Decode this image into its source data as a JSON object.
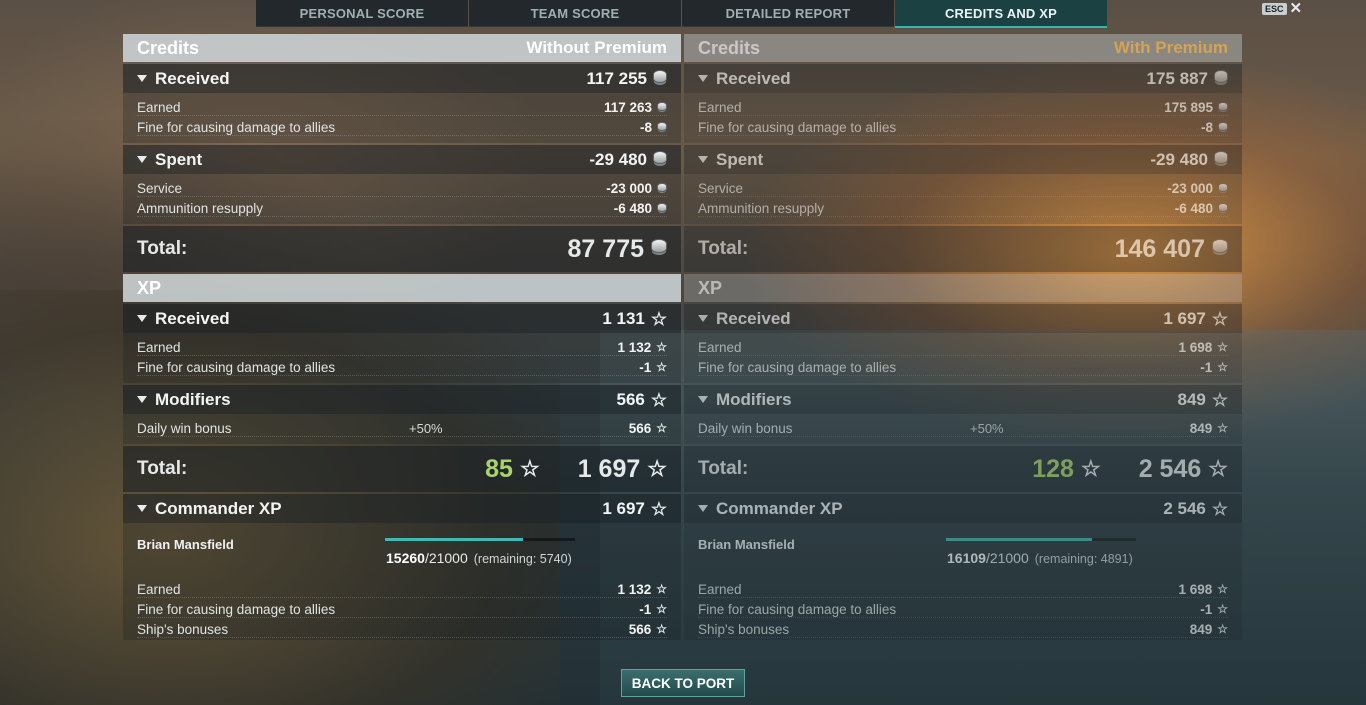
{
  "tabs": [
    {
      "label": "PERSONAL SCORE",
      "active": false
    },
    {
      "label": "TEAM SCORE",
      "active": false
    },
    {
      "label": "DETAILED REPORT",
      "active": false
    },
    {
      "label": "CREDITS AND XP",
      "active": true
    }
  ],
  "esc_label": "ESC",
  "left": {
    "credits_title": "Credits",
    "credits_mode": "Without Premium",
    "received": {
      "label": "Received",
      "value": "117 255",
      "rows": [
        {
          "label": "Earned",
          "value": "117 263"
        },
        {
          "label": "Fine for causing damage to allies",
          "value": "-8"
        }
      ]
    },
    "spent": {
      "label": "Spent",
      "value": "-29 480",
      "rows": [
        {
          "label": "Service",
          "value": "-23 000"
        },
        {
          "label": "Ammunition resupply",
          "value": "-6 480"
        }
      ]
    },
    "credits_total": {
      "label": "Total:",
      "value": "87 775"
    },
    "xp_title": "XP",
    "xp_received": {
      "label": "Received",
      "value": "1 131",
      "rows": [
        {
          "label": "Earned",
          "value": "1 132"
        },
        {
          "label": "Fine for causing damage to allies",
          "value": "-1"
        }
      ]
    },
    "modifiers": {
      "label": "Modifiers",
      "value": "566",
      "rows": [
        {
          "label": "Daily win bonus",
          "mid": "+50%",
          "value": "566"
        }
      ]
    },
    "xp_total": {
      "label": "Total:",
      "free": "85",
      "value": "1 697"
    },
    "commander": {
      "label": "Commander XP",
      "value": "1 697",
      "name": "Brian Mansfield",
      "current": "15260",
      "max": "/21000",
      "remaining": "(remaining: 5740)",
      "progress": 0.727,
      "rows": [
        {
          "label": "Earned",
          "value": "1 132"
        },
        {
          "label": "Fine for causing damage to allies",
          "value": "-1"
        },
        {
          "label": "Ship's bonuses",
          "value": "566"
        }
      ]
    }
  },
  "right": {
    "credits_title": "Credits",
    "credits_mode": "With Premium",
    "received": {
      "label": "Received",
      "value": "175 887",
      "rows": [
        {
          "label": "Earned",
          "value": "175 895"
        },
        {
          "label": "Fine for causing damage to allies",
          "value": "-8"
        }
      ]
    },
    "spent": {
      "label": "Spent",
      "value": "-29 480",
      "rows": [
        {
          "label": "Service",
          "value": "-23 000"
        },
        {
          "label": "Ammunition resupply",
          "value": "-6 480"
        }
      ]
    },
    "credits_total": {
      "label": "Total:",
      "value": "146 407"
    },
    "xp_title": "XP",
    "xp_received": {
      "label": "Received",
      "value": "1 697",
      "rows": [
        {
          "label": "Earned",
          "value": "1 698"
        },
        {
          "label": "Fine for causing damage to allies",
          "value": "-1"
        }
      ]
    },
    "modifiers": {
      "label": "Modifiers",
      "value": "849",
      "rows": [
        {
          "label": "Daily win bonus",
          "mid": "+50%",
          "value": "849"
        }
      ]
    },
    "xp_total": {
      "label": "Total:",
      "free": "128",
      "value": "2 546"
    },
    "commander": {
      "label": "Commander XP",
      "value": "2 546",
      "name": "Brian Mansfield",
      "current": "16109",
      "max": "/21000",
      "remaining": "(remaining: 4891)",
      "progress": 0.767,
      "rows": [
        {
          "label": "Earned",
          "value": "1 698"
        },
        {
          "label": "Fine for causing damage to allies",
          "value": "-1"
        },
        {
          "label": "Ship's bonuses",
          "value": "849"
        }
      ]
    }
  },
  "back_button": "BACK TO PORT"
}
